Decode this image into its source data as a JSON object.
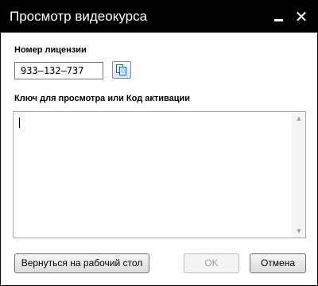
{
  "window": {
    "title": "Просмотр видеокурса",
    "controls": {
      "minimize": "minimize-icon",
      "close": "close-icon"
    },
    "close_glyph": "✕"
  },
  "license": {
    "label": "Номер лицензии",
    "value": "933–132–737",
    "copy_icon": "copy-icon"
  },
  "activation": {
    "label": "Ключ для просмотра или Код активации",
    "value": ""
  },
  "scrollbar": {
    "up": "▲",
    "down": "▼"
  },
  "buttons": {
    "back": "Вернуться на рабочий стол",
    "ok": "OK",
    "cancel": "Отмена"
  },
  "colors": {
    "titlebar": "#000000",
    "title_text": "#ffffff",
    "disabled_text": "#a0a0a0"
  }
}
